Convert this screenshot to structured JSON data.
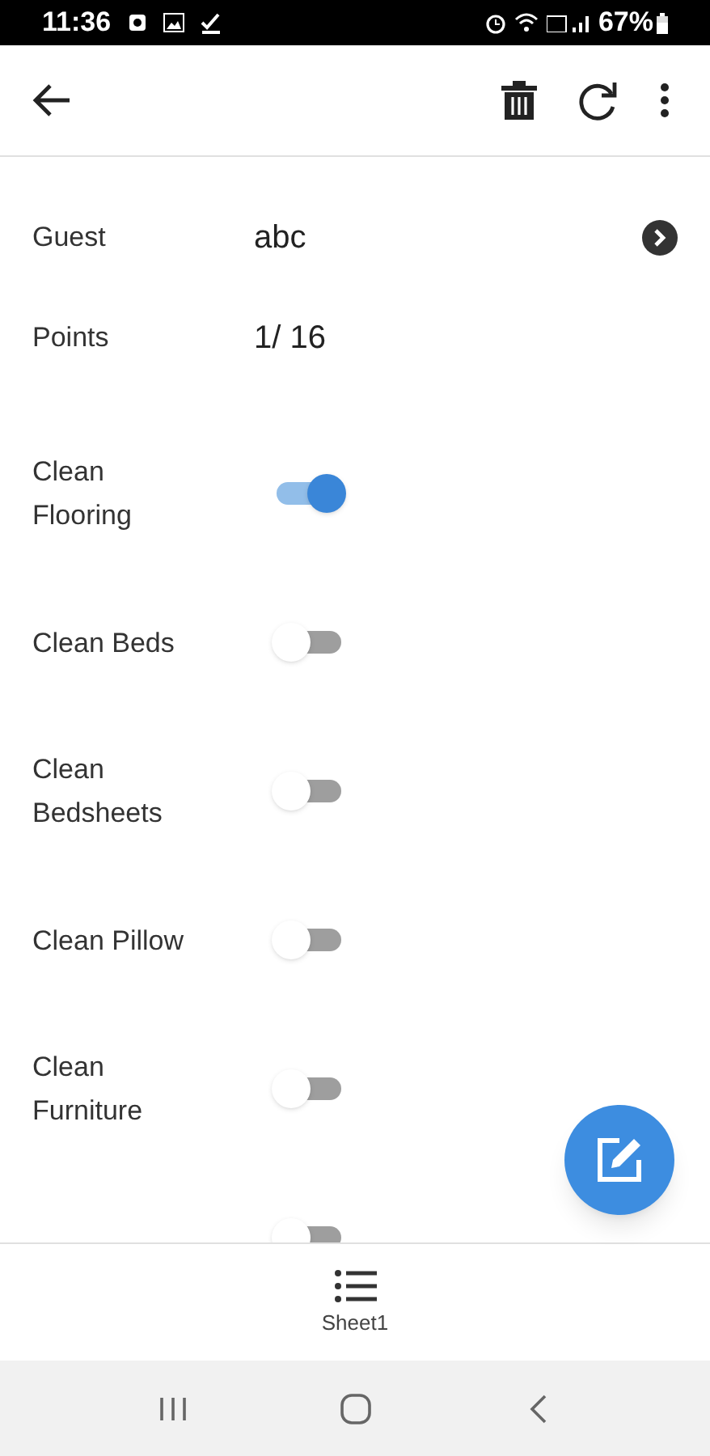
{
  "status_bar": {
    "time": "11:36",
    "battery_text": "67%"
  },
  "fields": [
    {
      "label": "Guest",
      "value": "abc",
      "has_link": true
    },
    {
      "label": "Points",
      "value": "1/ 16",
      "has_link": false
    }
  ],
  "tasks": [
    {
      "label": "Clean Flooring",
      "on": true
    },
    {
      "label": "Clean Beds",
      "on": false
    },
    {
      "label": "Clean Bedsheets",
      "on": false
    },
    {
      "label": "Clean Pillow",
      "on": false
    },
    {
      "label": "Clean Furniture",
      "on": false
    },
    {
      "on": false
    }
  ],
  "bottom_nav": [
    {
      "label": "Sheet1"
    }
  ]
}
